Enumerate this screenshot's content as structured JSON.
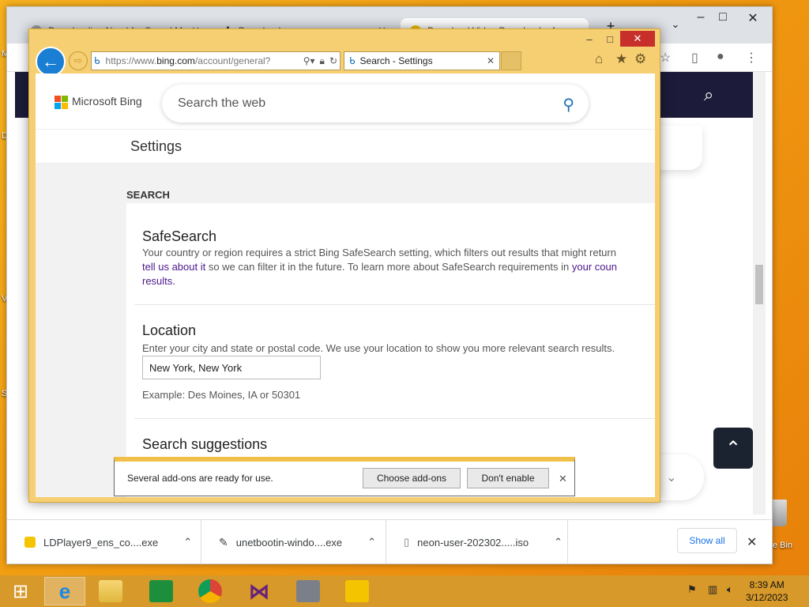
{
  "desktop": {
    "fragments": [
      "M",
      "D",
      "V",
      "S"
    ],
    "recycle_bin_label": "e Bin"
  },
  "chrome": {
    "tabs": [
      {
        "label": "Downloading Need for Speed M"
      },
      {
        "label": "Downloads"
      },
      {
        "label": "Download Video Downloader fo"
      }
    ],
    "downloads": [
      {
        "name": "LDPlayer9_ens_co....exe"
      },
      {
        "name": "unetbootin-windo....exe"
      },
      {
        "name": "neon-user-202302.....iso"
      }
    ],
    "show_all_label": "Show all"
  },
  "ie": {
    "address": {
      "scheme": "https://www.",
      "host": "bing.com",
      "path": "/account/general?"
    },
    "tab_title": "Search - Settings",
    "bing": {
      "logo_text": "Microsoft Bing",
      "search_placeholder": "Search the web",
      "settings_title": "Settings",
      "section_heading": "SEARCH",
      "safesearch": {
        "title": "SafeSearch",
        "line1": "Your country or region requires a strict Bing SafeSearch setting, which filters out results that might return",
        "link1": "tell us about it",
        "line2_mid": " so we can filter it in the future. To learn more about SafeSearch requirements in ",
        "link2": "your coun",
        "line3": "results."
      },
      "location": {
        "title": "Location",
        "description": "Enter your city and state or postal code. We use your location to show you more relevant search results.",
        "value": "New York, New York",
        "example": "Example: Des Moines, IA or 50301"
      },
      "suggestions_title": "Search suggestions"
    },
    "notification": {
      "text": "Several add-ons are ready for use.",
      "choose_label": "Choose add-ons",
      "dont_label": "Don't enable"
    }
  },
  "taskbar": {
    "apps": [
      "start",
      "internet-explorer",
      "file-explorer",
      "store",
      "chrome",
      "visual-studio",
      "tool",
      "ldplayer"
    ],
    "time": "8:39 AM",
    "date": "3/12/2023"
  },
  "colors": {
    "desktop": "#f19c12",
    "ie_frame": "#f5cf72",
    "bing_link": "#4b168c",
    "close_red": "#c7302a"
  }
}
